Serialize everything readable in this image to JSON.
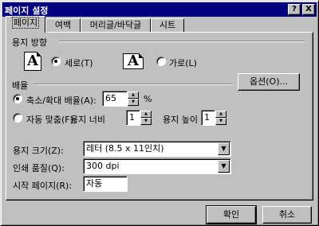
{
  "window": {
    "title": "페이지 설정",
    "help_glyph": "?",
    "close_glyph": "X"
  },
  "tabs": [
    {
      "label": "페이지",
      "active": true
    },
    {
      "label": "여백",
      "active": false
    },
    {
      "label": "머리글/바닥글",
      "active": false
    },
    {
      "label": "시트",
      "active": false
    }
  ],
  "orientation": {
    "heading": "용지 방향",
    "portrait": {
      "icon_letter": "A",
      "label": "세로(T)",
      "selected": true
    },
    "landscape": {
      "icon_letter": "A",
      "label": "가로(L)",
      "selected": false
    }
  },
  "options_button": "옵션(O)...",
  "scaling": {
    "heading": "배율",
    "adjust": {
      "label": "축소/확대 배율(A):",
      "value": "65",
      "unit": "%",
      "selected": true
    },
    "fit": {
      "label": "자동 맞춤(F):",
      "selected": false,
      "wide_label": "용지 너비",
      "wide_value": "1",
      "tall_label": "용지 높이",
      "tall_value": "1"
    }
  },
  "paper_size": {
    "label": "용지 크기(Z):",
    "value": "레터 (8.5 x 11인치)"
  },
  "print_quality": {
    "label": "인쇄 품질(Q):",
    "value": "300 dpi"
  },
  "first_page": {
    "label": "시작 페이지(R):",
    "value": "자동"
  },
  "buttons": {
    "ok": "확인",
    "cancel": "취소"
  },
  "icons": {
    "dropdown": "dropdown-arrow-icon",
    "spin_up": "spin-up-icon",
    "spin_down": "spin-down-icon"
  }
}
